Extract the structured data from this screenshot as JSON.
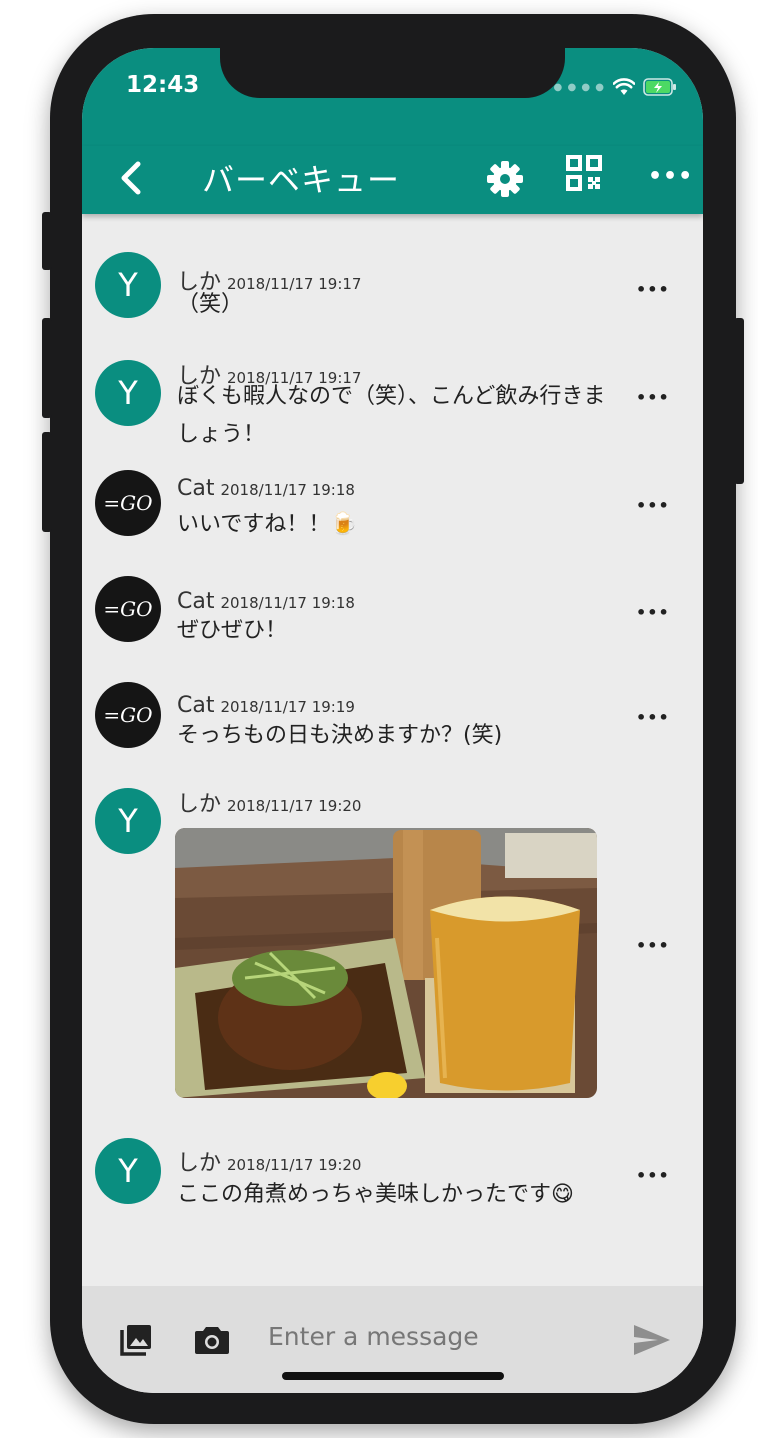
{
  "status": {
    "time": "12:43"
  },
  "header": {
    "title": "バーベキュー",
    "back_icon": "chevron-left-icon",
    "settings_icon": "gear-icon",
    "qr_icon": "qr-code-icon",
    "more_label": "•••"
  },
  "messages": [
    {
      "sender": "しか",
      "time": "2018/11/17 19:17",
      "text": "（笑）",
      "avatar": "Y"
    },
    {
      "sender": "しか",
      "time": "2018/11/17 19:17",
      "text": "ぼくも暇人なので（笑）、こんど飲み行きましょう！",
      "avatar": "Y"
    },
    {
      "sender": "Cat",
      "time": "2018/11/17 19:18",
      "text": "いいですね！！🍺",
      "avatar": "=GO"
    },
    {
      "sender": "Cat",
      "time": "2018/11/17 19:18",
      "text": "ぜひぜひ！",
      "avatar": "=GO"
    },
    {
      "sender": "Cat",
      "time": "2018/11/17 19:19",
      "text": "そっちもの日も決めますか？(笑)",
      "avatar": "=GO"
    },
    {
      "sender": "しか",
      "time": "2018/11/17 19:20",
      "text": "",
      "avatar": "Y"
    },
    {
      "sender": "しか",
      "time": "2018/11/17 19:20",
      "text": "ここの角煮めっちゃ美味しかったです😋",
      "avatar": "Y"
    }
  ],
  "more_label": "•••",
  "input": {
    "placeholder": "Enter a message"
  },
  "colors": {
    "primary": "#0a8e80",
    "background": "#ececec",
    "input_bar": "#dddddd"
  }
}
